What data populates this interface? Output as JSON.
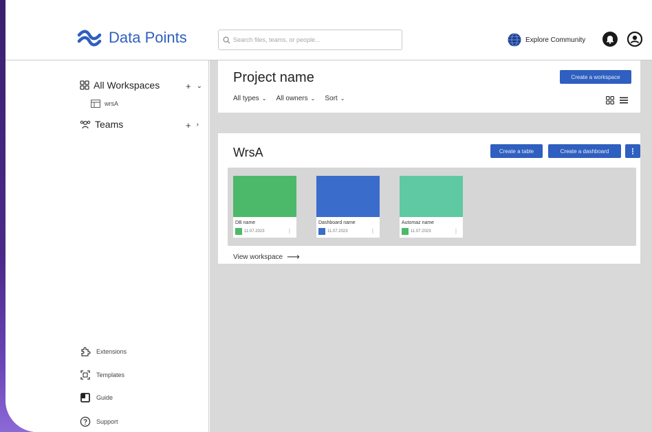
{
  "colors": {
    "accent": "#2f5fbf",
    "frame": "#4b2a8a",
    "canvas": "#d9d9d9"
  },
  "header": {
    "app_name": "Data Points",
    "search_placeholder": "Search files, teams, or people...",
    "explore_label": "Explore Community"
  },
  "sidebar": {
    "all_workspaces": "All Workspaces",
    "workspace_item": "wrsA",
    "teams": "Teams",
    "bottom": [
      {
        "label": "Extensions",
        "icon": "puzzle-icon"
      },
      {
        "label": "Templates",
        "icon": "templates-icon"
      },
      {
        "label": "Guide",
        "icon": "guide-icon"
      },
      {
        "label": "Support",
        "icon": "help-icon"
      }
    ]
  },
  "project": {
    "title": "Project name",
    "create_workspace": "Create a workspace",
    "filters": [
      "All types",
      "All owners",
      "Sort"
    ]
  },
  "workspace": {
    "title": "WrsA",
    "create_table": "Create a table",
    "create_dashboard": "Create a dashboard",
    "more": "⋮",
    "view_label": "View workspace",
    "cards": [
      {
        "name": "DB name",
        "date": "11.07.2023",
        "color": "#4cb86a",
        "icon_color": "#4cb86a"
      },
      {
        "name": "Dashboard name",
        "date": "11.07.2023",
        "color": "#3a6ccc",
        "icon_color": "#3a6ccc"
      },
      {
        "name": "Automaz name",
        "date": "11.07.2023",
        "color": "#5fc9a3",
        "icon_color": "#4cb86a"
      }
    ]
  }
}
